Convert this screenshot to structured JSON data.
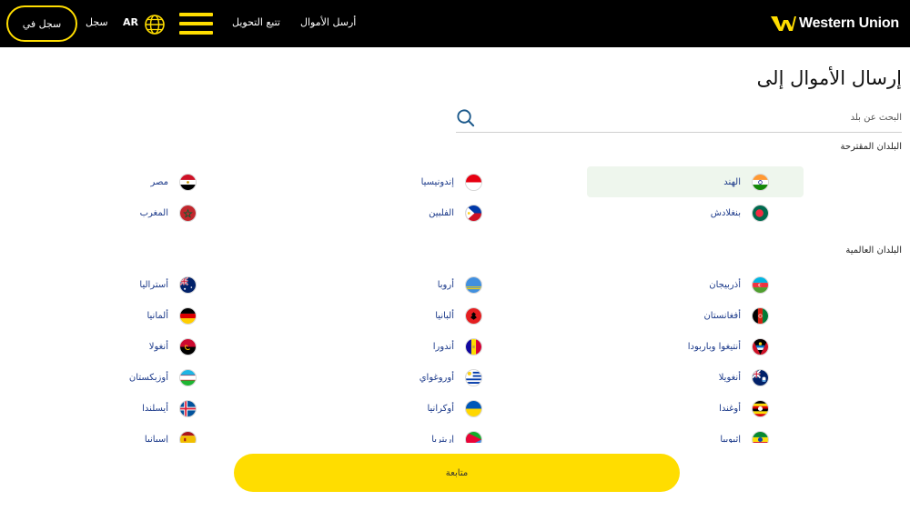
{
  "header": {
    "brand": "Western Union",
    "nav": {
      "send_money": "أرسل الأموال",
      "track_transfer": "تتبع التحويل"
    },
    "language": "AR",
    "register": "سجل",
    "login": "سجل في"
  },
  "main": {
    "title": "إرسال الأموال إلى",
    "search": {
      "placeholder": "البحث عن بلد",
      "value": ""
    },
    "suggested": {
      "title": "البلدان المقترحة",
      "items": [
        {
          "name": "الهند",
          "flag": "india-flag-icon",
          "selected": true
        },
        {
          "name": "إندونيسيا",
          "flag": "indonesia-flag-icon"
        },
        {
          "name": "مصر",
          "flag": "egypt-flag-icon"
        },
        {
          "name": "بنغلادش",
          "flag": "bangladesh-flag-icon"
        },
        {
          "name": "الفلبين",
          "flag": "philippines-flag-icon"
        },
        {
          "name": "المغرب",
          "flag": "morocco-flag-icon"
        }
      ]
    },
    "global": {
      "title": "البلدان العالمية",
      "items": [
        {
          "name": "أذربيجان",
          "flag": "azerbaijan-flag-icon"
        },
        {
          "name": "أروبا",
          "flag": "aruba-flag-icon"
        },
        {
          "name": "أستراليا",
          "flag": "australia-flag-icon"
        },
        {
          "name": "أفغانستان",
          "flag": "afghanistan-flag-icon"
        },
        {
          "name": "ألبانيا",
          "flag": "albania-flag-icon"
        },
        {
          "name": "ألمانيا",
          "flag": "germany-flag-icon"
        },
        {
          "name": "أنتيغوا وباربودا",
          "flag": "antigua-flag-icon"
        },
        {
          "name": "أندورا",
          "flag": "andorra-flag-icon"
        },
        {
          "name": "أنغولا",
          "flag": "angola-flag-icon"
        },
        {
          "name": "أنغويلا",
          "flag": "anguilla-flag-icon"
        },
        {
          "name": "أوروغواي",
          "flag": "uruguay-flag-icon"
        },
        {
          "name": "أوزبكستان",
          "flag": "uzbekistan-flag-icon"
        },
        {
          "name": "أوغندا",
          "flag": "uganda-flag-icon"
        },
        {
          "name": "أوكرانيا",
          "flag": "ukraine-flag-icon"
        },
        {
          "name": "أيسلندا",
          "flag": "iceland-flag-icon"
        },
        {
          "name": "إثيوبيا",
          "flag": "ethiopia-flag-icon"
        },
        {
          "name": "إريتريا",
          "flag": "eritrea-flag-icon"
        },
        {
          "name": "إسبانيا",
          "flag": "spain-flag-icon"
        }
      ]
    },
    "continue_label": "متابعة"
  },
  "colors": {
    "brand_yellow": "#ffdd00",
    "header_bg": "#000000",
    "country_text": "#1c3a8a",
    "selected_bg": "#eef6ed"
  }
}
